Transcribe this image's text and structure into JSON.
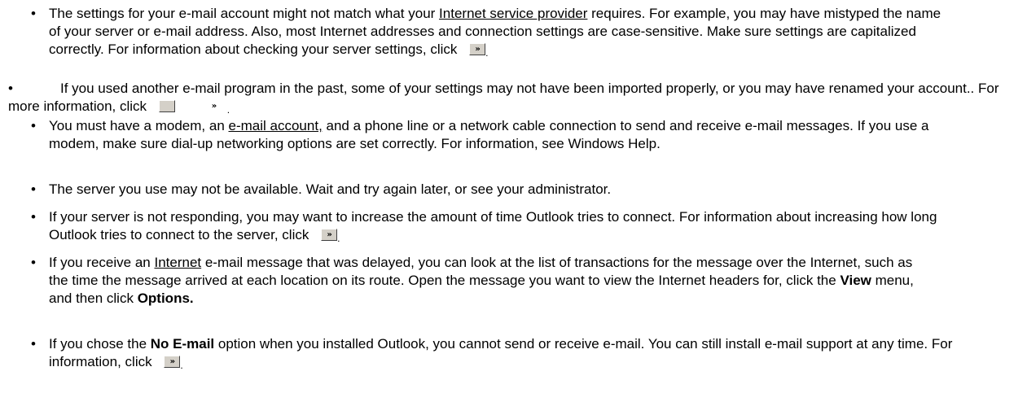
{
  "items": [
    {
      "bullet": "•",
      "parts": [
        {
          "t": "The settings for your e-mail account might not match what your "
        },
        {
          "t": "Internet service provider",
          "u": true
        },
        {
          "t": " requires. For example, you may have mistyped the name of your server or e-mail address. Also, most Internet addresses and connection settings are case-sensitive. Make sure settings are capitalized correctly. For information about checking your server settings, click "
        }
      ],
      "jump": true
    },
    {
      "bullet": "•",
      "parts": [
        {
          "t": "If you used another e-mail program in the past, some of your settings may not have been imported properly, or you may have renamed your account.. For more information, click "
        }
      ],
      "jump": true
    },
    {
      "bullet": "•",
      "parts": [
        {
          "t": "You must have a modem, an "
        },
        {
          "t": "e-mail account,",
          "u": true
        },
        {
          "t": " and a phone line or a network cable connection to send and receive e-mail messages. If you use a modem, make sure dial-up networking options are set correctly. For information, see Windows Help."
        }
      ]
    },
    {
      "bullet": "•",
      "parts": [
        {
          "t": "The server you use may not be available. Wait and try again later, or see your administrator."
        }
      ]
    },
    {
      "bullet": "•",
      "parts": [
        {
          "t": "If your server is   not responding, you may want to increase the amount of time Outlook tries to connect. For information about increasing how long Outlook tries to connect to the server, click "
        }
      ],
      "jump": true
    },
    {
      "bullet": "•",
      "parts": [
        {
          "t": "If you receive an "
        },
        {
          "t": "Internet",
          "u": true
        },
        {
          "t": " e-mail message that was delayed, you can look at the list of transactions for the message over the Internet, such as the time the message arrived at each location on its route. Open the message you want to view the Internet headers for, click the "
        },
        {
          "t": "View",
          "b": true
        },
        {
          "t": " menu, and then click "
        },
        {
          "t": "Options.",
          "b": true
        }
      ]
    },
    {
      "bullet": "•",
      "parts": [
        {
          "t": "If you chose the "
        },
        {
          "t": "No E-mail",
          "b": true
        },
        {
          "t": " option when you installed Outlook, you cannot send or receive e-mail. You can still install e-mail support at any time. For information, click "
        }
      ],
      "jump": true
    }
  ],
  "jump_glyph": "»",
  "jump_trail": "."
}
